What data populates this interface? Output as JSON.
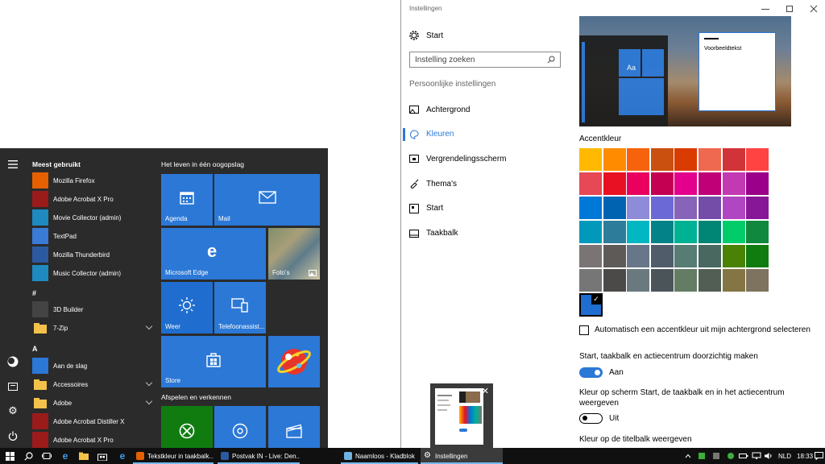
{
  "start_menu": {
    "rail": [
      "hamburger-icon",
      "user-icon",
      "file-explorer-icon",
      "gear-icon",
      "power-icon"
    ],
    "most_used_heading": "Meest gebruikt",
    "most_used": [
      {
        "label": "Mozilla Firefox",
        "icon": "firefox-icon",
        "color": "#e66000"
      },
      {
        "label": "Adobe Acrobat X Pro",
        "icon": "acrobat-icon",
        "color": "#9b1b1b"
      },
      {
        "label": "Movie Collector (admin)",
        "icon": "movie-collector-icon",
        "color": "#1f8ac0"
      },
      {
        "label": "TextPad",
        "icon": "textpad-icon",
        "color": "#3a7bd5"
      },
      {
        "label": "Mozilla Thunderbird",
        "icon": "thunderbird-icon",
        "color": "#2c5aa0"
      },
      {
        "label": "Music Collector (admin)",
        "icon": "music-collector-icon",
        "color": "#1f8ac0"
      }
    ],
    "group_hash": "#",
    "hash_apps": [
      {
        "label": "3D Builder",
        "icon": "3d-builder-icon",
        "color": "#444444",
        "expandable": false
      },
      {
        "label": "7-Zip",
        "icon": "folder-icon",
        "color": "#f2c24a",
        "expandable": true
      }
    ],
    "group_a": "A",
    "a_apps": [
      {
        "label": "Aan de slag",
        "icon": "lightbulb-icon",
        "color": "#2b78d6",
        "expandable": false
      },
      {
        "label": "Accessoires",
        "icon": "folder-icon",
        "color": "#f2c24a",
        "expandable": true
      },
      {
        "label": "Adobe",
        "icon": "folder-icon",
        "color": "#f2c24a",
        "expandable": true
      },
      {
        "label": "Adobe Acrobat Distiller X",
        "icon": "distiller-icon",
        "color": "#9b1b1b",
        "expandable": false
      },
      {
        "label": "Adobe Acrobat X Pro",
        "icon": "acrobat-icon",
        "color": "#9b1b1b",
        "expandable": false
      }
    ],
    "tiles_heading_1": "Het leven in één oogopslag",
    "tiles_heading_2": "Afspelen en verkennen",
    "tiles": {
      "agenda": "Agenda",
      "mail": "Mail",
      "edge": "Microsoft Edge",
      "photos": "Foto's",
      "weather": "Weer",
      "phone": "Telefoonassist...",
      "store": "Store"
    }
  },
  "settings": {
    "window_title": "Instellingen",
    "home_label": "Start",
    "search_placeholder": "Instelling zoeken",
    "section_heading": "Persoonlijke instellingen",
    "nav": [
      {
        "label": "Achtergrond",
        "icon": "picture-icon"
      },
      {
        "label": "Kleuren",
        "icon": "palette-icon"
      },
      {
        "label": "Vergrendelingsscherm",
        "icon": "lock-screen-icon"
      },
      {
        "label": "Thema's",
        "icon": "brush-icon"
      },
      {
        "label": "Start",
        "icon": "start-icon"
      },
      {
        "label": "Taakbalk",
        "icon": "taskbar-icon"
      }
    ],
    "active_nav": "Kleuren",
    "preview_sample_text": "Voorbeeldtekst",
    "preview_tile_text": "Aa",
    "accent_heading": "Accentkleur",
    "accent_colors": [
      [
        "#ffb900",
        "#ff8c00",
        "#f7630c",
        "#ca5010",
        "#da3b01",
        "#ef6950",
        "#d13438",
        "#ff4343"
      ],
      [
        "#e74856",
        "#e81123",
        "#ea005e",
        "#c30052",
        "#e3008c",
        "#bf0077",
        "#c239b3",
        "#9a0089"
      ],
      [
        "#0078d7",
        "#0063b1",
        "#8e8cd8",
        "#6b69d6",
        "#8764b8",
        "#744da9",
        "#b146c2",
        "#881798"
      ],
      [
        "#0099bc",
        "#2d7d9a",
        "#00b7c3",
        "#038387",
        "#00b294",
        "#018574",
        "#00cc6a",
        "#10893e"
      ],
      [
        "#7a7574",
        "#5d5a58",
        "#68768a",
        "#515c6b",
        "#567c73",
        "#486860",
        "#498205",
        "#107c10"
      ],
      [
        "#767676",
        "#4c4a48",
        "#69797e",
        "#4a5459",
        "#647c64",
        "#525e54",
        "#847545",
        "#7e735f"
      ]
    ],
    "selected_color": "#1f6ecf",
    "auto_accent_label": "Automatisch een accentkleur uit mijn achtergrond selecteren",
    "transparency_label": "Start, taakbalk en actiecentrum doorzichtig maken",
    "transparency_state": "Aan",
    "color_on_start_label_1": "Kleur op scherm Start, de taakbalk en in het actiecentrum",
    "color_on_start_label_2": "weergeven",
    "color_on_start_state": "Uit",
    "titlebar_label": "Kleur op de titelbalk weergeven"
  },
  "taskbar": {
    "apps": [
      {
        "label": "Tekstkleur in taakbalk...",
        "icon": "firefox-icon",
        "color": "#e66000",
        "active": false
      },
      {
        "label": "Postvak IN - Live: Den...",
        "icon": "thunderbird-icon",
        "color": "#2c5aa0",
        "active": false
      },
      {
        "label": "Naamloos - Kladblok",
        "icon": "notepad-icon",
        "color": "#6fb3e0",
        "active": false
      },
      {
        "label": "Instellingen",
        "icon": "gear-icon",
        "color": "#ffffff",
        "active": true
      }
    ],
    "language": "NLD",
    "time": "18:33"
  }
}
